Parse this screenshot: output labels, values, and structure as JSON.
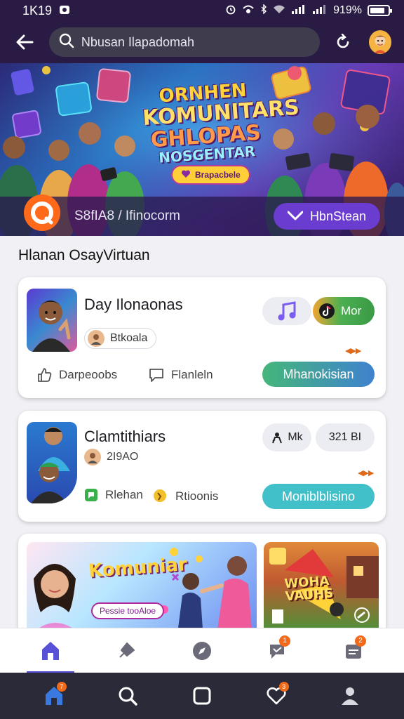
{
  "status_bar": {
    "time": "1K19",
    "battery": "919%"
  },
  "header": {
    "search_value": "Nbusan Ilapadomah"
  },
  "banner": {
    "title_line1": "ORNHEN",
    "title_line2": "KOMUNITARS",
    "title_line3": "GHLOPAS",
    "title_line4": "NOSGENTAR",
    "chip_label": "Brapacbele",
    "brand_text": "S8fIA8 / Ifinocorm",
    "join_label": "HbnStean"
  },
  "section": {
    "title": "Hlanan OsayVirtuan"
  },
  "cards": [
    {
      "title": "Day Ilonaonas",
      "user_label": "Btkoala",
      "tag_label": "Mor",
      "action1_label": "Darpeoobs",
      "action2_label": "Flanleln",
      "cta_label": "Mhanokisian"
    },
    {
      "title": "Clamtithiars",
      "user_label": "2I9AO",
      "pill1_label": "Mk",
      "pill2_label": "321 BI",
      "action1_label": "Rlehan",
      "action2_label": "Rtioonis",
      "cta_label": "Moniblblisino"
    },
    {
      "title": "Komuniar",
      "chip_label": "Pessie tooAloe",
      "side_title": "WOHA VAUHS"
    }
  ],
  "bottom_nav": {
    "items": [
      "home",
      "pin",
      "explore",
      "messages",
      "inbox"
    ],
    "badges": [
      "",
      "",
      "",
      "1",
      "2"
    ]
  },
  "sys_nav": {
    "badges": [
      "7",
      "",
      "",
      "3",
      ""
    ]
  },
  "colors": {
    "header_bg": "#2a1b44",
    "accent": "#6a3ccf",
    "cta_green": "#45b67a",
    "cta_teal": "#41c0c9",
    "badge": "#f06a1a"
  }
}
